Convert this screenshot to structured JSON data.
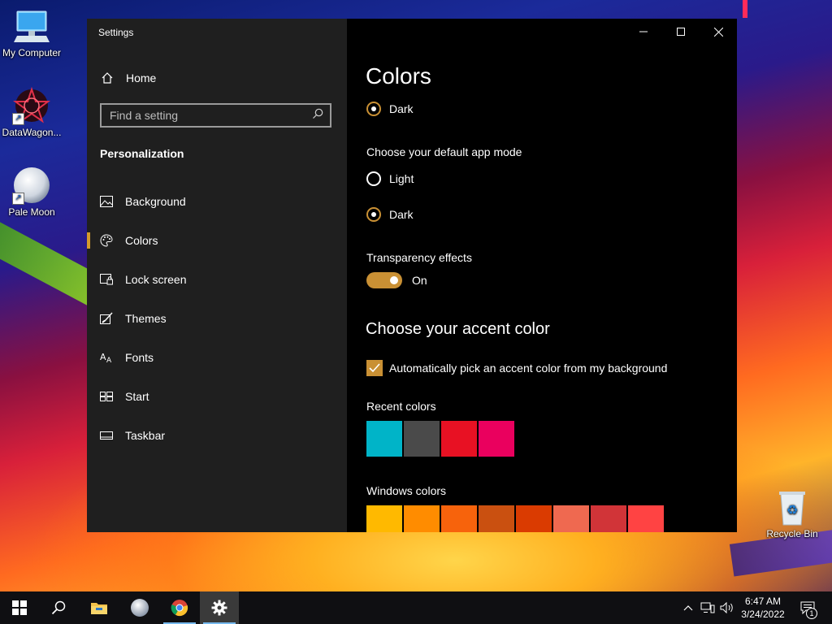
{
  "desktop": {
    "icons": [
      {
        "label": "My Computer"
      },
      {
        "label": "DataWagon..."
      },
      {
        "label": "Pale Moon"
      },
      {
        "label": "Recycle Bin"
      }
    ]
  },
  "window": {
    "title": "Settings",
    "controls": {
      "minimize": "—",
      "maximize": "☐",
      "close": "✕"
    }
  },
  "sidebar": {
    "home_label": "Home",
    "search_placeholder": "Find a setting",
    "section_title": "Personalization",
    "items": [
      {
        "label": "Background",
        "icon": "image-icon"
      },
      {
        "label": "Colors",
        "icon": "palette-icon",
        "active": true
      },
      {
        "label": "Lock screen",
        "icon": "lock-screen-icon"
      },
      {
        "label": "Themes",
        "icon": "themes-icon"
      },
      {
        "label": "Fonts",
        "icon": "fonts-icon"
      },
      {
        "label": "Start",
        "icon": "start-icon"
      },
      {
        "label": "Taskbar",
        "icon": "taskbar-icon"
      }
    ]
  },
  "content": {
    "title": "Colors",
    "windows_mode_selected": "Dark",
    "app_mode": {
      "label": "Choose your default app mode",
      "options": [
        "Light",
        "Dark"
      ],
      "selected": "Dark"
    },
    "transparency": {
      "label": "Transparency effects",
      "state": "On"
    },
    "accent_heading": "Choose your accent color",
    "auto_accent": {
      "label": "Automatically pick an accent color from my background",
      "checked": true
    },
    "recent_colors": {
      "label": "Recent colors",
      "swatches": [
        "#00b4c8",
        "#4a4a4a",
        "#e81123",
        "#ea005e"
      ]
    },
    "windows_colors": {
      "label": "Windows colors",
      "swatches": [
        "#ffb900",
        "#ff8c00",
        "#f7630c",
        "#ca5010",
        "#da3b01",
        "#ef6950",
        "#d13438",
        "#ff4343"
      ]
    },
    "accent_color": "#c99034"
  },
  "taskbar": {
    "items": [
      "start-icon",
      "search-icon",
      "file-explorer-icon",
      "pale-moon-icon",
      "chrome-icon",
      "settings-icon"
    ],
    "time": "6:47 AM",
    "date": "3/24/2022",
    "notification_count": "1"
  }
}
